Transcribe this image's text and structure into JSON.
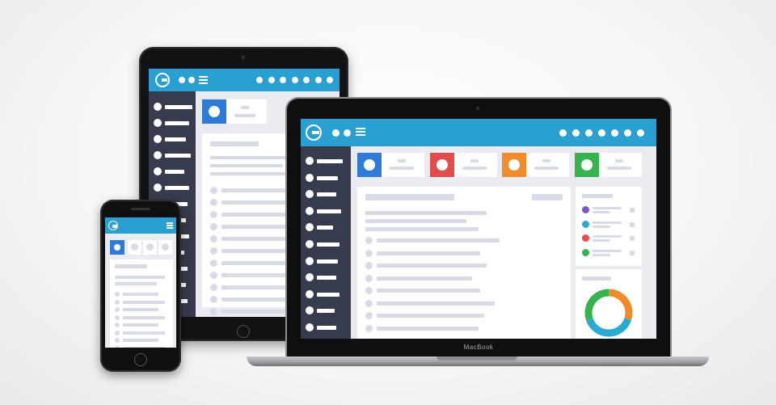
{
  "laptop": {
    "brand": "MacBook",
    "header": {
      "icons": [
        "logo-icon",
        "dot-icon",
        "dot-icon",
        "menu-icon"
      ],
      "right_dot_count": 7
    },
    "stat_tiles": [
      {
        "color": "#2f7ad8"
      },
      {
        "color": "#e24c4b"
      },
      {
        "color": "#f08b2c"
      },
      {
        "color": "#36b34c"
      }
    ],
    "legend_colors": [
      "#7b57c1",
      "#2aa9d4",
      "#e24c4b",
      "#36b34c"
    ],
    "donut": [
      {
        "color": "#f08b2c",
        "value": 0.3
      },
      {
        "color": "#2aa9d4",
        "value": 0.4
      },
      {
        "color": "#36b34c",
        "value": 0.3
      }
    ]
  },
  "tablet": {
    "header": {
      "icons": [
        "logo-icon",
        "dot-icon",
        "dot-icon",
        "menu-icon"
      ],
      "right_dot_count": 7
    },
    "stat_tile": {
      "color": "#2f7ad8"
    }
  },
  "phone": {
    "header": {
      "icons": [
        "logo-icon",
        "menu-icon"
      ]
    },
    "stat_tile": {
      "color": "#2f7ad8"
    }
  },
  "colors": {
    "accent": "#2a9fd1",
    "sidebar": "#363c4d",
    "content_bg": "#e9ebf1",
    "placeholder": "#d7dbe5"
  }
}
